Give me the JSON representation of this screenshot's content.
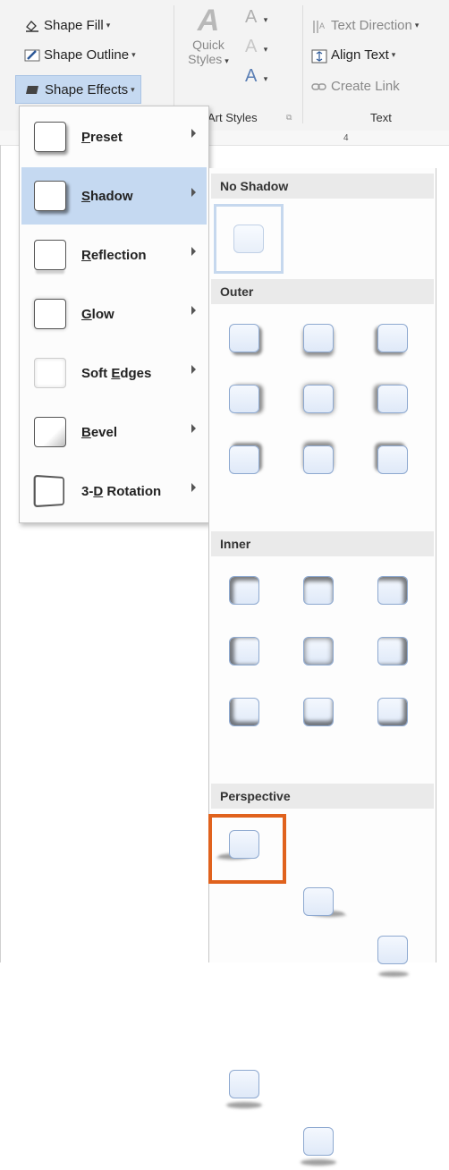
{
  "ribbon": {
    "shape_fill": "Shape Fill",
    "shape_outline": "Shape Outline",
    "shape_effects": "Shape Effects",
    "quick_styles_line1": "Quick",
    "quick_styles_line2": "Styles",
    "wordart_group_label": "Art Styles",
    "text_direction": "Text Direction",
    "align_text": "Align Text",
    "create_link": "Create Link",
    "text_group_label": "Text",
    "ruler_mark": "4"
  },
  "menu": {
    "items": [
      {
        "pre": "",
        "u": "P",
        "post": "reset",
        "icon": "preset-thumb"
      },
      {
        "pre": "",
        "u": "S",
        "post": "hadow",
        "icon": "shadow-thumb"
      },
      {
        "pre": "",
        "u": "R",
        "post": "eflection",
        "icon": "reflection-thumb"
      },
      {
        "pre": "",
        "u": "G",
        "post": "low",
        "icon": "glow-thumb"
      },
      {
        "pre": "Soft ",
        "u": "E",
        "post": "dges",
        "icon": "soft-edges-thumb"
      },
      {
        "pre": "",
        "u": "B",
        "post": "evel",
        "icon": "bevel-thumb"
      },
      {
        "pre": "3-",
        "u": "D",
        "post": " Rotation",
        "icon": "rotation-thumb"
      }
    ],
    "active_index": 1
  },
  "shadow_gallery": {
    "sections": {
      "no_shadow": "No Shadow",
      "outer": "Outer",
      "inner": "Inner",
      "perspective": "Perspective"
    }
  },
  "colors": {
    "active_highlight": "#c5d9f1",
    "callout_border": "#e0621d",
    "swatch_fill": "#dfe9f8"
  }
}
